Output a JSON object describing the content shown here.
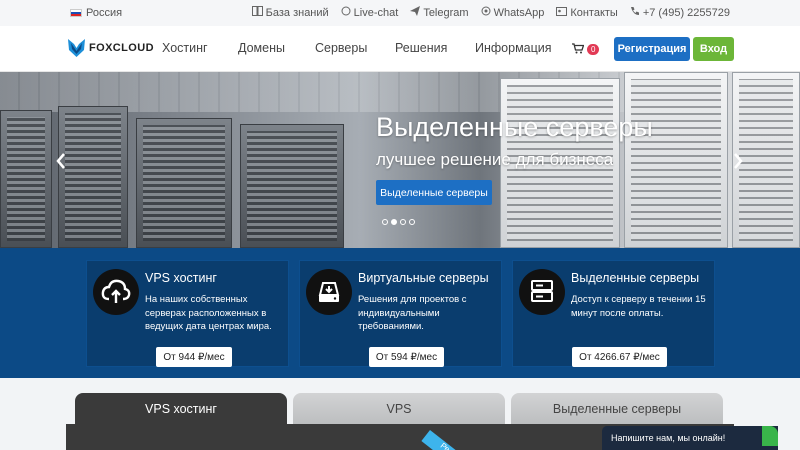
{
  "topbar": {
    "region": "Россия",
    "links": [
      {
        "icon": "book-icon",
        "label": "База знаний"
      },
      {
        "icon": "chat-bubble-icon",
        "label": "Live-chat"
      },
      {
        "icon": "telegram-icon",
        "label": "Telegram"
      },
      {
        "icon": "whatsapp-icon",
        "label": "WhatsApp"
      },
      {
        "icon": "contacts-card-icon",
        "label": "Контакты"
      },
      {
        "icon": "phone-icon",
        "label": "+7 (495) 2255729"
      }
    ]
  },
  "nav": {
    "logo": "FOXCLOUD",
    "items": [
      "Хостинг",
      "Домены",
      "Серверы",
      "Решения",
      "Информация"
    ],
    "cart_count": "0",
    "register_label": "Регистрация",
    "login_label": "Вход"
  },
  "hero": {
    "title": "Выделенные серверы",
    "subtitle": "лучшее решение для бизнеса",
    "button": "Выделенные серверы",
    "slides": 4,
    "active_slide": 2
  },
  "features": [
    {
      "icon": "cloud-upload-icon",
      "title": "VPS хостинг",
      "desc": "На наших собственных серверах расположенных в ведущих дата центрах мира.",
      "price": "От 944 ₽/мес"
    },
    {
      "icon": "hdd-drive-icon",
      "title": "Виртуальные серверы",
      "desc": "Решения для проектов с индивидуальными требованиями.",
      "price": "От 594 ₽/мес"
    },
    {
      "icon": "server-rack-icon",
      "title": "Выделенные серверы",
      "desc": "Доступ к серверу в течении 15 минут после оплаты.",
      "price": "От 4266.67 ₽/мес"
    }
  ],
  "tabs": [
    {
      "label": "VPS хостинг",
      "active": true
    },
    {
      "label": "VPS",
      "active": false
    },
    {
      "label": "Выделенные серверы",
      "active": false
    }
  ],
  "ribbon": "Ре",
  "chat": {
    "label": "Напишите нам, мы онлайн!"
  },
  "colors": {
    "primary": "#1d6fc4",
    "success": "#6cb638",
    "features_bg": "#0c4a86",
    "badge": "#e23a55"
  }
}
